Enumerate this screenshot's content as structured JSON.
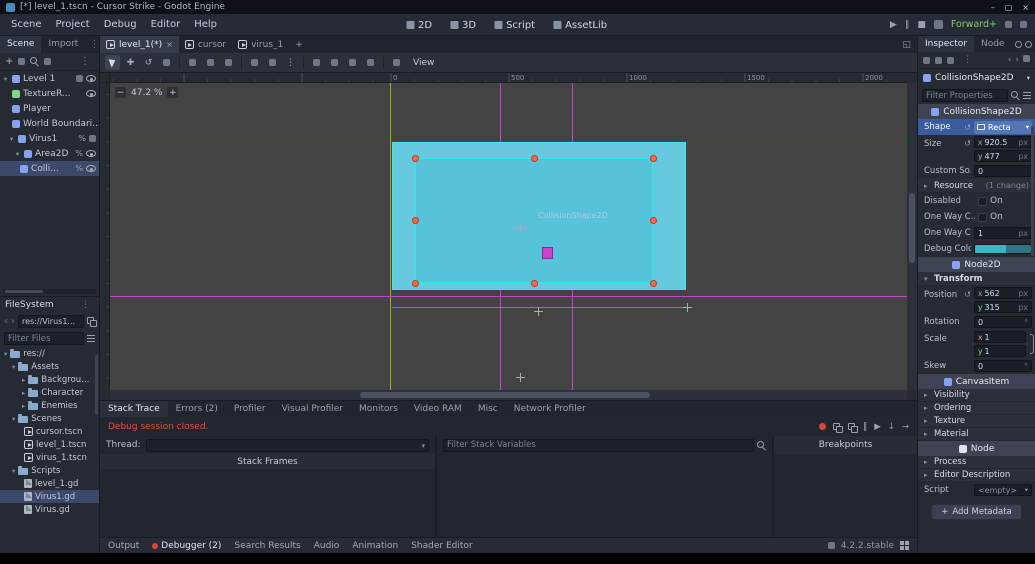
{
  "window": {
    "title": "[*] level_1.tscn - Cursor Strike - Godot Engine"
  },
  "menubar": {
    "menus": [
      "Scene",
      "Project",
      "Debug",
      "Editor",
      "Help"
    ],
    "workspaces": [
      "2D",
      "3D",
      "Script",
      "AssetLib"
    ],
    "renderer": "Forward+"
  },
  "scene_dock": {
    "tabs": [
      "Scene",
      "Import"
    ],
    "nodes": [
      "Level 1",
      "TextureR...",
      "Player",
      "World Boundari...",
      "Virus1",
      "Area2D",
      "Colli..."
    ]
  },
  "filesystem": {
    "title": "FileSystem",
    "path": "res://Virus1...",
    "filter_placeholder": "Filter Files",
    "items": [
      "res://",
      "Assets",
      "Backgrou...",
      "Character",
      "Enemies",
      "Scenes",
      "cursor.tscn",
      "level_1.tscn",
      "virus_1.tscn",
      "Scripts",
      "level_1.gd",
      "Virus1.gd",
      "Virus.gd"
    ]
  },
  "scene_tabs": {
    "tabs": [
      "level_1(*)",
      "cursor",
      "virus_1"
    ]
  },
  "viewport": {
    "view_menu": "View",
    "zoom": "47.2 %",
    "ruler_labels": [
      "0",
      "500",
      "1000",
      "1500",
      "2000"
    ],
    "selected_node_label": "CollisionShape2D"
  },
  "debugger": {
    "tabs": [
      "Stack Trace",
      "Errors (2)",
      "Profiler",
      "Visual Profiler",
      "Monitors",
      "Video RAM",
      "Misc",
      "Network Profiler"
    ],
    "message": "Debug session closed.",
    "thread_label": "Thread:",
    "filter_placeholder": "Filter Stack Variables",
    "stack_frames": "Stack Frames",
    "breakpoints": "Breakpoints"
  },
  "bottom_bar": {
    "tabs": [
      "Output",
      "Debugger (2)",
      "Search Results",
      "Audio",
      "Animation",
      "Shader Editor"
    ],
    "version": "4.2.2.stable"
  },
  "inspector": {
    "tabs": [
      "Inspector",
      "Node"
    ],
    "node_name": "CollisionShape2D",
    "filter_placeholder": "Filter Properties",
    "category_shape": "CollisionShape2D",
    "shape_label": "Shape",
    "shape_value": "Recta",
    "size_label": "Size",
    "size_x": "920.5",
    "size_y": "477",
    "px": "px",
    "custom_label": "Custom So...",
    "custom_value": "0",
    "resource_label": "Resource",
    "resource_badge": "(1 change)",
    "disabled_label": "Disabled",
    "disabled_value": "On",
    "one_way_label": "One Way C...",
    "one_way_value": "On",
    "one_way_margin_label": "One Way C...",
    "one_way_margin_value": "1",
    "debug_color_label": "Debug Color",
    "debug_color": "#3fb2c8",
    "category_node2d": "Node2D",
    "transform_label": "Transform",
    "position_label": "Position",
    "position_x": "562",
    "position_y": "315",
    "rotation_label": "Rotation",
    "rotation_value": "0",
    "deg": "°",
    "scale_label": "Scale",
    "scale_x": "1",
    "scale_y": "1",
    "skew_label": "Skew",
    "skew_value": "0",
    "category_canvasitem": "CanvasItem",
    "canvasitem_groups": [
      "Visibility",
      "Ordering",
      "Texture",
      "Material"
    ],
    "category_node": "Node",
    "node_groups": [
      "Process",
      "Editor Description"
    ],
    "script_label": "Script",
    "script_value": "<empty>",
    "add_metadata": "Add Metadata"
  },
  "colors": {
    "accent": "#5377b6",
    "collision_fill": "#66c9de",
    "collision_border": "#3ae0f2",
    "selection_handle": "#ff6847",
    "guide_magenta": "#c743c7",
    "guide_yellow": "#a3ad1c",
    "error_red": "#e0533d",
    "renderer_green": "#83c86a"
  }
}
